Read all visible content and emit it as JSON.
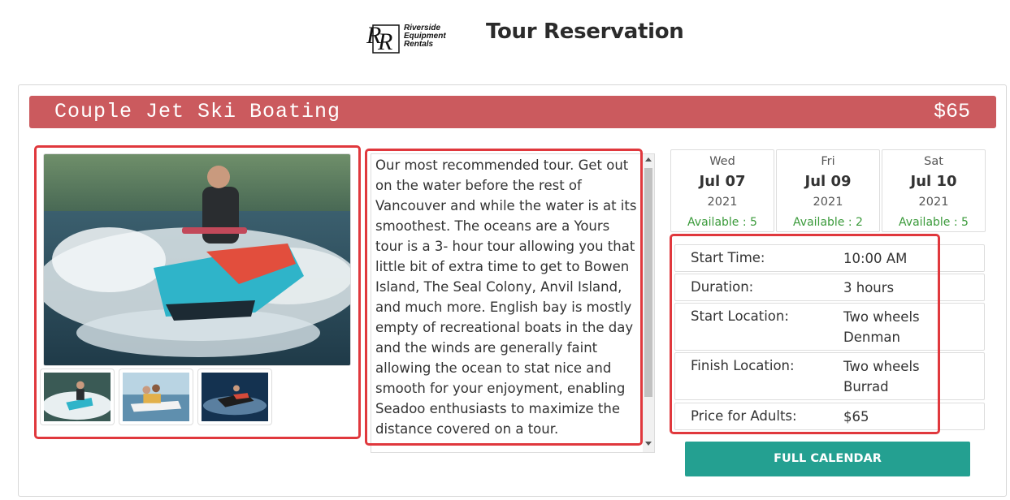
{
  "header": {
    "logo_lines": [
      "Riverside",
      "Equipment",
      "Rentals"
    ],
    "title": "Tour Reservation"
  },
  "tour": {
    "name": "Couple Jet Ski Boating",
    "price": "$65",
    "banner_color": "#cb5a5e",
    "description": "Our most recommended tour. Get out on the water before the rest of Vancouver and while the water is at its smoothest. The oceans are a Yours tour is a 3- hour tour allowing you that little bit of extra time to get to Bowen Island, The Seal Colony, Anvil Island, and much more. English bay is mostly empty of recreational boats in the day and the winds are generally faint allowing the ocean to stat nice and smooth for your enjoyment, enabling Seadoo enthusiasts to maximize the distance covered on a tour."
  },
  "dates": [
    {
      "dow": "Wed",
      "md": "Jul 07",
      "year": "2021",
      "available": "Available : 5"
    },
    {
      "dow": "Fri",
      "md": "Jul 09",
      "year": "2021",
      "available": "Available : 2"
    },
    {
      "dow": "Sat",
      "md": "Jul 10",
      "year": "2021",
      "available": "Available : 5"
    }
  ],
  "details": [
    {
      "label": "Start Time:",
      "value": "10:00 AM"
    },
    {
      "label": "Duration:",
      "value": "3 hours"
    },
    {
      "label": "Start Location:",
      "value": "Two wheels Denman"
    },
    {
      "label": "Finish Location:",
      "value": "Two wheels Burrad"
    },
    {
      "label": "Price for Adults:",
      "value": "$65"
    }
  ],
  "buttons": {
    "full_calendar": "FULL CALENDAR"
  },
  "colors": {
    "accent": "#24a091",
    "highlight": "#e0383d",
    "available": "#3a9a3a"
  }
}
